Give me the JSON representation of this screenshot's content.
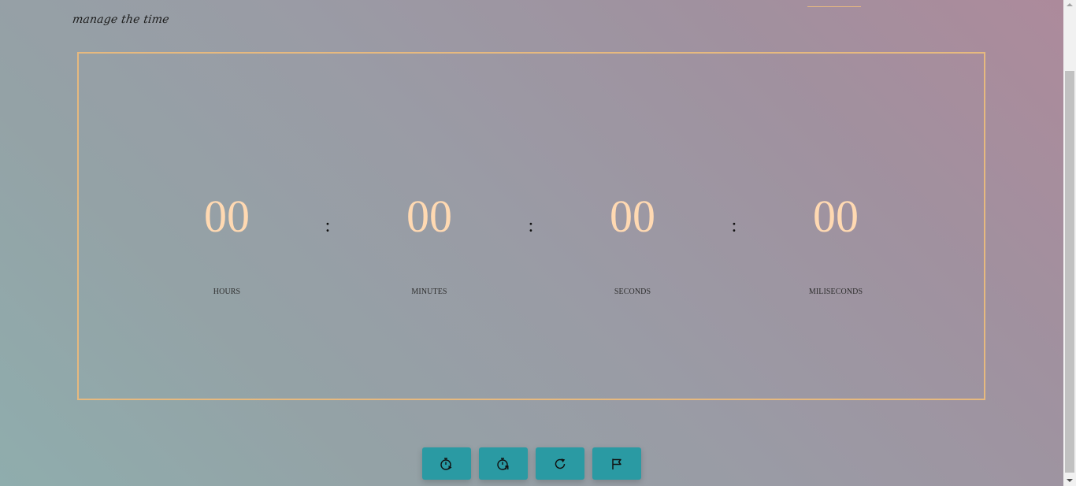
{
  "header": {
    "tagline": "manage the time"
  },
  "timer": {
    "units": [
      {
        "value": "00",
        "label": "HOURS"
      },
      {
        "value": "00",
        "label": "MINUTES"
      },
      {
        "value": "00",
        "label": "SECONDS"
      },
      {
        "value": "00",
        "label": "MILISECONDS"
      }
    ],
    "separator": ":"
  },
  "controls": {
    "buttons": [
      {
        "icon": "stopwatch-start-icon"
      },
      {
        "icon": "stopwatch-pause-icon"
      },
      {
        "icon": "reset-icon"
      },
      {
        "icon": "flag-icon"
      }
    ]
  },
  "colors": {
    "frame": "#e6b97f",
    "digits": "#ffd9b2",
    "button": "#2a9aa3"
  }
}
